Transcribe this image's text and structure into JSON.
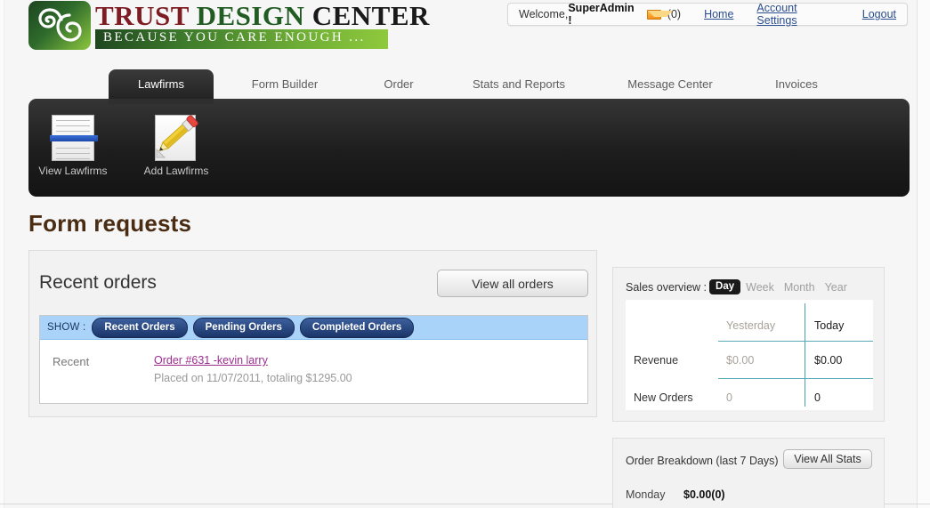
{
  "logo": {
    "word1": "TRUST ",
    "word2": "DESIGN ",
    "word3": "CENTER",
    "tagline": "BECAUSE YOU CARE ENOUGH ...",
    "mark_icon": "swirl-logo-icon"
  },
  "header": {
    "welcome_prefix": "Welcome, ",
    "username": "SuperAdmin !",
    "mail_icon": "envelope-icon",
    "message_count": "(0)",
    "links": [
      {
        "label": "Home"
      },
      {
        "label": "Account Settings"
      },
      {
        "label": "Logout"
      }
    ]
  },
  "tabs": [
    {
      "label": "Lawfirms",
      "active": true
    },
    {
      "label": "Form Builder",
      "active": false
    },
    {
      "label": "Order",
      "active": false
    },
    {
      "label": "Stats and Reports",
      "active": false
    },
    {
      "label": "Message Center",
      "active": false
    },
    {
      "label": "Invoices",
      "active": false
    }
  ],
  "toolbar": {
    "items": [
      {
        "label": "View Lawfirms",
        "icon": "list-lines-icon"
      },
      {
        "label": "Add Lawfirms",
        "icon": "pencil-paper-icon"
      }
    ]
  },
  "page": {
    "title": "Form requests"
  },
  "recent_orders": {
    "heading": "Recent orders",
    "view_all_label": "View all orders",
    "show_label": "SHOW :",
    "filters": [
      {
        "label": "Recent Orders"
      },
      {
        "label": "Pending Orders"
      },
      {
        "label": "Completed Orders"
      }
    ],
    "rows": [
      {
        "group": "Recent",
        "link": "Order #631 -kevin larry",
        "detail": "Placed on 11/07/2011, totaling $1295.00"
      }
    ]
  },
  "sales_overview": {
    "title": "Sales overview :",
    "ranges": [
      {
        "label": "Day",
        "active": true
      },
      {
        "label": "Week",
        "active": false
      },
      {
        "label": "Month",
        "active": false
      },
      {
        "label": "Year",
        "active": false
      }
    ],
    "columns": [
      {
        "label": "Yesterday"
      },
      {
        "label": "Today"
      }
    ],
    "rows": [
      {
        "label": "Revenue",
        "yesterday": "$0.00",
        "today": "$0.00"
      },
      {
        "label": "New Orders",
        "yesterday": "0",
        "today": "0"
      }
    ]
  },
  "order_breakdown": {
    "title": "Order Breakdown (last 7 Days)",
    "view_stats_label": "View All Stats",
    "rows": [
      {
        "day": "Monday",
        "value": "$0.00(0)"
      }
    ]
  },
  "colors": {
    "accent_green": "#8cc63f",
    "dark_green": "#20471f",
    "brand_red": "#7d1c22",
    "link_blue": "#2a4d8f",
    "order_link": "#9c2c8f",
    "pill_navy": "#1b3569",
    "show_bar_blue": "#a9d3f9",
    "toolbar_dark": "#1d1d1d",
    "title_brown": "#4a2c12",
    "table_rule_teal": "#5aa9b8"
  }
}
